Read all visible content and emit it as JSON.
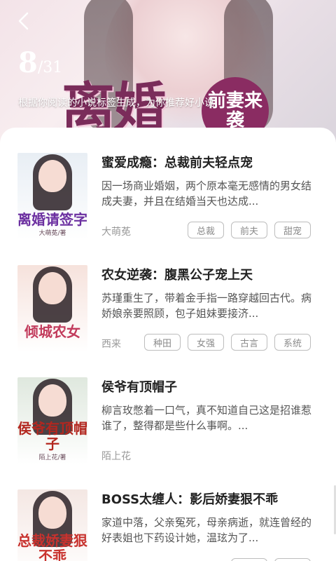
{
  "header": {
    "back_icon": "chevron-left-icon",
    "current_index": "8",
    "total": "/31",
    "subtitle": "根据你阅读的小说标签生成，为你推荐好小说",
    "banner_title": "离婚",
    "banner_badge": "前妻来袭"
  },
  "books": [
    {
      "title": "蜜爱成瘾：总裁前夫轻点宠",
      "desc": "因一场商业婚姻，两个原本毫无感情的男女结成夫妻，并且在结婚当天也达成...",
      "author": "大萌莬",
      "tags": [
        "总裁",
        "前夫",
        "甜宠"
      ],
      "cover_text": "离婚请签字",
      "cover_author": "大萌莬/著",
      "cover_bg": "#e8eef4",
      "cover_color": "#6b2fa0"
    },
    {
      "title": "农女逆袭：腹黑公子宠上天",
      "desc": "苏瑾重生了，带着金手指一路穿越回古代。病娇娘亲要照顾，包子姐妹要接济...",
      "author": "西来",
      "tags": [
        "种田",
        "女强",
        "古言",
        "系统"
      ],
      "cover_text": "倾城农女",
      "cover_author": "",
      "cover_bg": "#f6e2dc",
      "cover_color": "#c23b5c"
    },
    {
      "title": "侯爷有顶帽子",
      "desc": "柳言玫憋着一口气，真不知道自己这是招谁惹谁了，整得都是些什么事啊。...",
      "author": "陌上花",
      "tags": [],
      "cover_text": "侯爷有顶帽子",
      "cover_author": "陌上花/著",
      "cover_bg": "#dfe8de",
      "cover_color": "#b3271f"
    },
    {
      "title": "BOSS太缠人：影后娇妻狠不乖",
      "desc": "家道中落，父亲冤死，母亲病逝，就连曾经的好表姐也下药设计她，温玹为了...",
      "author": "",
      "tags": [
        "",
        ""
      ],
      "cover_text": "总裁娇妻狠不乖",
      "cover_author": "",
      "cover_bg": "#f4e7e3",
      "cover_color": "#c8322e"
    }
  ]
}
